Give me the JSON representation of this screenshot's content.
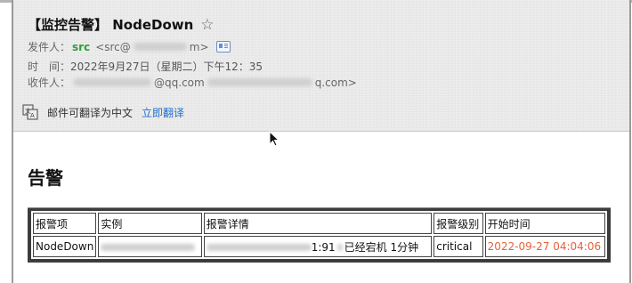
{
  "email": {
    "subject": "【监控告警】 NodeDown",
    "from_label": "发件人：",
    "from_name": "src",
    "from_addr_start": "<src@",
    "from_addr_end": "m>",
    "time_label": "时　间：",
    "time_value": "2022年9月27日（星期二）下午12：35",
    "to_label": "收件人：",
    "to_fragment_1": "@qq.com",
    "to_fragment_2": "q.com>"
  },
  "translate": {
    "prompt": "邮件可翻译为中文",
    "action": "立即翻译"
  },
  "body": {
    "heading": "告警"
  },
  "table": {
    "headers": [
      "报警项",
      "实例",
      "报警详情",
      "报警级别",
      "开始时间"
    ],
    "row": {
      "item": "NodeDown",
      "detail_tail": "1:91",
      "detail_text": "已经宕机 1分钟",
      "level": "critical",
      "start_time": "2022-09-27 04:04:06"
    }
  },
  "colors": {
    "link": "#1e6fd0",
    "time_text": "#e8603a",
    "sender": "#2e9e3a"
  },
  "icons": [
    "star-icon",
    "contact-card-icon",
    "translate-icon",
    "mouse-cursor-icon"
  ]
}
